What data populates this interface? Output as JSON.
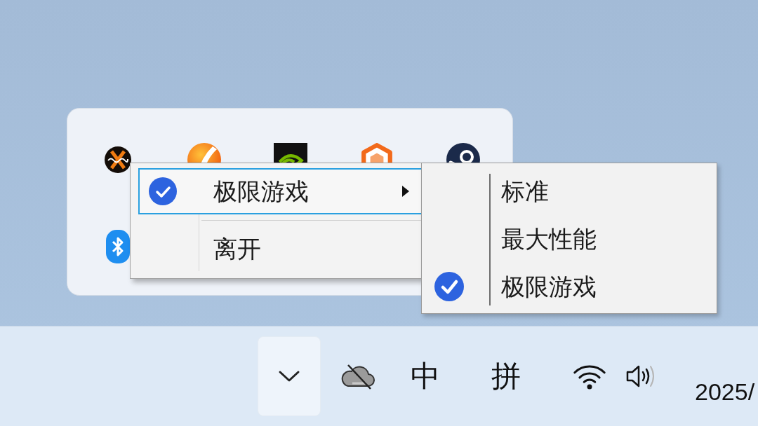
{
  "context_menu": {
    "items": [
      {
        "label": "极限游戏",
        "checked": true,
        "selected": true,
        "has_submenu": true
      },
      {
        "label": "离开",
        "checked": false,
        "selected": false,
        "has_submenu": false
      }
    ]
  },
  "submenu": {
    "items": [
      {
        "label": "标准",
        "checked": false
      },
      {
        "label": "最大性能",
        "checked": false
      },
      {
        "label": "极限游戏",
        "checked": true
      }
    ]
  },
  "taskbar": {
    "language_indicator": "中",
    "input_method": "拼",
    "clock": "2025/"
  }
}
